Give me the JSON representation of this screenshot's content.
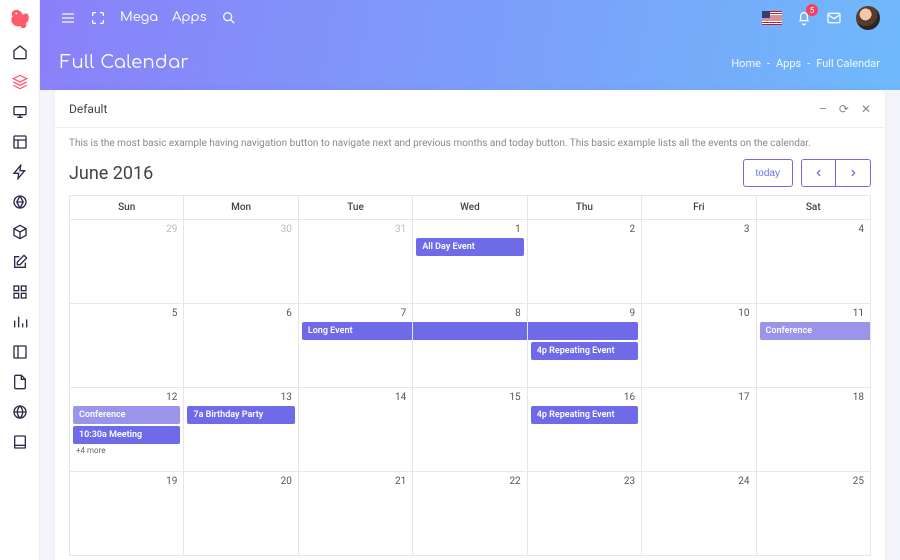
{
  "brand": {
    "mega": "Mega",
    "apps": "Apps"
  },
  "notifications": {
    "count": "5"
  },
  "page": {
    "title": "Full Calendar"
  },
  "breadcrumb": {
    "home": "Home",
    "apps": "Apps",
    "current": "Full Calendar",
    "sep": "-"
  },
  "card": {
    "title": "Default",
    "desc": "This is the most basic example having navigation button to navigate next and previous months and today button. This basic example lists all the events on the calendar."
  },
  "calendar": {
    "title": "June 2016",
    "today": "today",
    "days": [
      "Sun",
      "Mon",
      "Tue",
      "Wed",
      "Thu",
      "Fri",
      "Sat"
    ],
    "weeks": [
      [
        {
          "n": "29",
          "other": true
        },
        {
          "n": "30",
          "other": true
        },
        {
          "n": "31",
          "other": true
        },
        {
          "n": "1",
          "ev": [
            {
              "t": "All Day Event"
            }
          ]
        },
        {
          "n": "2"
        },
        {
          "n": "3"
        },
        {
          "n": "4"
        }
      ],
      [
        {
          "n": "5"
        },
        {
          "n": "6"
        },
        {
          "n": "7",
          "ev": [
            {
              "t": "Long Event",
              "span": "start"
            }
          ]
        },
        {
          "n": "8",
          "ev": [
            {
              "t": "Long Event",
              "span": "mid"
            }
          ]
        },
        {
          "n": "9",
          "ev": [
            {
              "t": "Long Event",
              "span": "end"
            },
            {
              "t": "4p Repeating Event"
            }
          ]
        },
        {
          "n": "10"
        },
        {
          "n": "11",
          "ev": [
            {
              "t": "Conference",
              "lt": true,
              "span": "start"
            }
          ]
        }
      ],
      [
        {
          "n": "12",
          "ev": [
            {
              "t": "Conference",
              "lt": true
            },
            {
              "t": "10:30a Meeting"
            }
          ],
          "more": "+4 more"
        },
        {
          "n": "13",
          "ev": [
            {
              "t": "7a Birthday Party"
            }
          ]
        },
        {
          "n": "14"
        },
        {
          "n": "15"
        },
        {
          "n": "16",
          "ev": [
            {
              "t": "4p Repeating Event"
            }
          ]
        },
        {
          "n": "17"
        },
        {
          "n": "18"
        }
      ],
      [
        {
          "n": "19"
        },
        {
          "n": "20"
        },
        {
          "n": "21"
        },
        {
          "n": "22"
        },
        {
          "n": "23"
        },
        {
          "n": "24"
        },
        {
          "n": "25"
        }
      ]
    ]
  }
}
